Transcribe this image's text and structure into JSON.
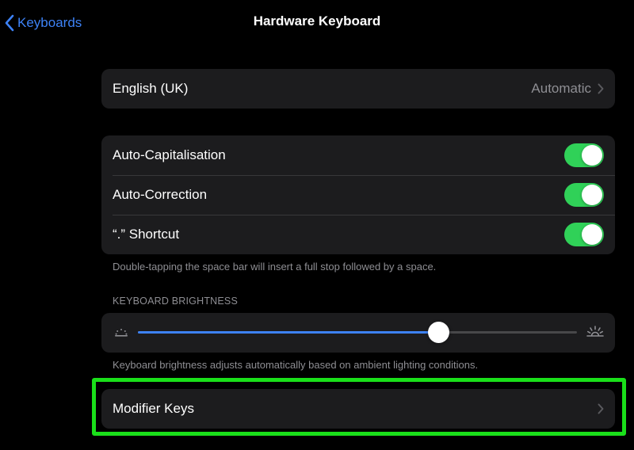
{
  "nav": {
    "back_label": "Keyboards",
    "title": "Hardware Keyboard"
  },
  "language": {
    "label": "English (UK)",
    "value": "Automatic"
  },
  "toggles": [
    {
      "label": "Auto-Capitalisation",
      "on": true
    },
    {
      "label": "Auto-Correction",
      "on": true
    },
    {
      "label": "“.” Shortcut",
      "on": true
    }
  ],
  "toggles_footer": "Double-tapping the space bar will insert a full stop followed by a space.",
  "brightness": {
    "header": "KEYBOARD BRIGHTNESS",
    "level_fraction": 0.685,
    "footer": "Keyboard brightness adjusts automatically based on ambient lighting conditions."
  },
  "modifier_keys": {
    "label": "Modifier Keys"
  },
  "colors": {
    "accent_blue": "#3d82f6",
    "toggle_green": "#30d158",
    "highlight_green": "#1ae01a",
    "cell_background": "#1c1c1e",
    "secondary_text": "#8e8e93"
  },
  "icons": {
    "back": "chevron-left-icon",
    "disclosure": "chevron-right-icon",
    "brightness_low": "brightness-low-icon",
    "brightness_high": "brightness-high-icon"
  }
}
